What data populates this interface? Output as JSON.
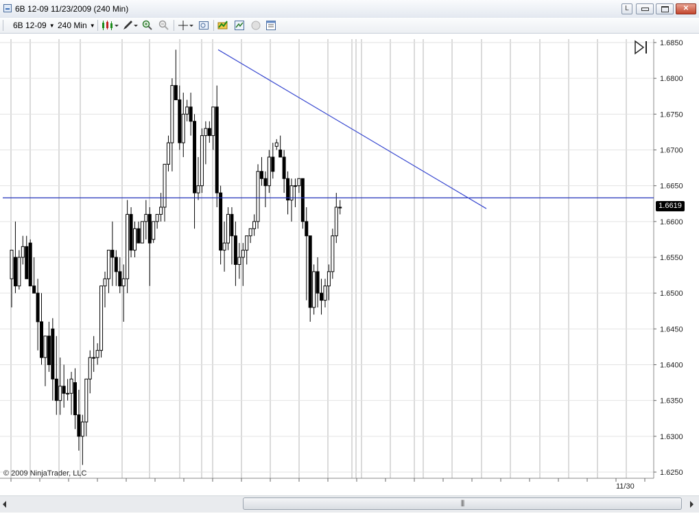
{
  "window": {
    "title": "6B 12-09  11/23/2009 (240 Min)",
    "btn_l": "L",
    "btn_close": "✕"
  },
  "toolbar": {
    "instrument": "6B 12-09",
    "interval": "240 Min"
  },
  "chart": {
    "copyright": "© 2009 NinjaTrader, LLC",
    "date_label": "11/30",
    "last_price": "1.6619",
    "price_labels": [
      "1.6850",
      "1.6800",
      "1.6750",
      "1.6700",
      "1.6650",
      "1.6600",
      "1.6550",
      "1.6500",
      "1.6450",
      "1.6400",
      "1.6350",
      "1.6300",
      "1.6250"
    ],
    "horizontal_line": 1.6633,
    "trendline": [
      {
        "x": 0,
        "y": 1.684
      },
      {
        "x": 1,
        "y": 1.6618
      }
    ],
    "colors": {
      "up_candle": "#ffffff",
      "down_candle": "#000000",
      "line": "#1f2fb8",
      "grid": "#a9a9a9"
    }
  },
  "chart_data": {
    "type": "candlestick",
    "ylim": [
      1.625,
      1.685
    ],
    "candles": [
      [
        1.652,
        1.656,
        1.648,
        1.656
      ],
      [
        1.655,
        1.66,
        1.65,
        1.651
      ],
      [
        1.651,
        1.656,
        1.6505,
        1.655
      ],
      [
        1.655,
        1.658,
        1.654,
        1.6565
      ],
      [
        1.6565,
        1.658,
        1.652,
        1.652
      ],
      [
        1.657,
        1.6575,
        1.651,
        1.651
      ],
      [
        1.651,
        1.655,
        1.65,
        1.65
      ],
      [
        1.65,
        1.652,
        1.642,
        1.646
      ],
      [
        1.646,
        1.65,
        1.64,
        1.641
      ],
      [
        1.641,
        1.644,
        1.637,
        1.644
      ],
      [
        1.644,
        1.646,
        1.639,
        1.64
      ],
      [
        1.645,
        1.6465,
        1.635,
        1.638
      ],
      [
        1.638,
        1.644,
        1.633,
        1.635
      ],
      [
        1.635,
        1.641,
        1.633,
        1.637
      ],
      [
        1.637,
        1.64,
        1.634,
        1.636
      ],
      [
        1.636,
        1.638,
        1.635,
        1.636
      ],
      [
        1.636,
        1.639,
        1.633,
        1.638
      ],
      [
        1.6375,
        1.6395,
        1.631,
        1.633
      ],
      [
        1.633,
        1.6365,
        1.628,
        1.63
      ],
      [
        1.63,
        1.633,
        1.626,
        1.632
      ],
      [
        1.632,
        1.638,
        1.63,
        1.638
      ],
      [
        1.638,
        1.642,
        1.636,
        1.641
      ],
      [
        1.641,
        1.644,
        1.639,
        1.641
      ],
      [
        1.641,
        1.643,
        1.64,
        1.642
      ],
      [
        1.642,
        1.646,
        1.641,
        1.651
      ],
      [
        1.651,
        1.653,
        1.648,
        1.652
      ],
      [
        1.652,
        1.656,
        1.65,
        1.656
      ],
      [
        1.656,
        1.66,
        1.651,
        1.655
      ],
      [
        1.655,
        1.656,
        1.651,
        1.653
      ],
      [
        1.653,
        1.655,
        1.65,
        1.651
      ],
      [
        1.651,
        1.654,
        1.646,
        1.652
      ],
      [
        1.652,
        1.663,
        1.65,
        1.661
      ],
      [
        1.661,
        1.662,
        1.655,
        1.656
      ],
      [
        1.656,
        1.66,
        1.655,
        1.659
      ],
      [
        1.659,
        1.66,
        1.657,
        1.657
      ],
      [
        1.657,
        1.66,
        1.657,
        1.66
      ],
      [
        1.66,
        1.663,
        1.6575,
        1.661
      ],
      [
        1.661,
        1.662,
        1.651,
        1.657
      ],
      [
        1.6575,
        1.66,
        1.657,
        1.66
      ],
      [
        1.66,
        1.661,
        1.659,
        1.661
      ],
      [
        1.661,
        1.664,
        1.66,
        1.662
      ],
      [
        1.662,
        1.668,
        1.66,
        1.668
      ],
      [
        1.668,
        1.672,
        1.667,
        1.671
      ],
      [
        1.671,
        1.68,
        1.667,
        1.679
      ],
      [
        1.679,
        1.684,
        1.678,
        1.677
      ],
      [
        1.677,
        1.679,
        1.67,
        1.671
      ],
      [
        1.671,
        1.678,
        1.669,
        1.675
      ],
      [
        1.675,
        1.677,
        1.674,
        1.676
      ],
      [
        1.676,
        1.678,
        1.672,
        1.674
      ],
      [
        1.674,
        1.675,
        1.659,
        1.664
      ],
      [
        1.664,
        1.669,
        1.663,
        1.665
      ],
      [
        1.665,
        1.673,
        1.664,
        1.672
      ],
      [
        1.672,
        1.674,
        1.668,
        1.673
      ],
      [
        1.673,
        1.674,
        1.671,
        1.672
      ],
      [
        1.672,
        1.676,
        1.67,
        1.676
      ],
      [
        1.676,
        1.679,
        1.662,
        1.664
      ],
      [
        1.664,
        1.665,
        1.654,
        1.656
      ],
      [
        1.656,
        1.66,
        1.653,
        1.657
      ],
      [
        1.657,
        1.662,
        1.656,
        1.661
      ],
      [
        1.661,
        1.662,
        1.654,
        1.658
      ],
      [
        1.658,
        1.66,
        1.651,
        1.654
      ],
      [
        1.654,
        1.657,
        1.652,
        1.655
      ],
      [
        1.655,
        1.657,
        1.651,
        1.656
      ],
      [
        1.656,
        1.658,
        1.654,
        1.658
      ],
      [
        1.658,
        1.659,
        1.657,
        1.659
      ],
      [
        1.659,
        1.661,
        1.658,
        1.66
      ],
      [
        1.66,
        1.668,
        1.659,
        1.667
      ],
      [
        1.667,
        1.669,
        1.665,
        1.666
      ],
      [
        1.666,
        1.667,
        1.662,
        1.665
      ],
      [
        1.665,
        1.67,
        1.664,
        1.669
      ],
      [
        1.669,
        1.671,
        1.666,
        1.667
      ],
      [
        1.6705,
        1.6715,
        1.67,
        1.671
      ],
      [
        1.67,
        1.672,
        1.669,
        1.669
      ],
      [
        1.669,
        1.67,
        1.664,
        1.666
      ],
      [
        1.666,
        1.667,
        1.661,
        1.663
      ],
      [
        1.663,
        1.666,
        1.66,
        1.665
      ],
      [
        1.665,
        1.666,
        1.662,
        1.665
      ],
      [
        1.665,
        1.666,
        1.664,
        1.666
      ],
      [
        1.666,
        1.666,
        1.659,
        1.66
      ],
      [
        1.66,
        1.662,
        1.649,
        1.658
      ],
      [
        1.658,
        1.658,
        1.646,
        1.648
      ],
      [
        1.648,
        1.654,
        1.647,
        1.653
      ],
      [
        1.653,
        1.655,
        1.648,
        1.65
      ],
      [
        1.65,
        1.652,
        1.647,
        1.649
      ],
      [
        1.649,
        1.652,
        1.648,
        1.651
      ],
      [
        1.651,
        1.654,
        1.649,
        1.653
      ],
      [
        1.653,
        1.659,
        1.652,
        1.658
      ],
      [
        1.658,
        1.664,
        1.657,
        1.662
      ],
      [
        1.662,
        1.663,
        1.661,
        1.6619
      ]
    ]
  }
}
